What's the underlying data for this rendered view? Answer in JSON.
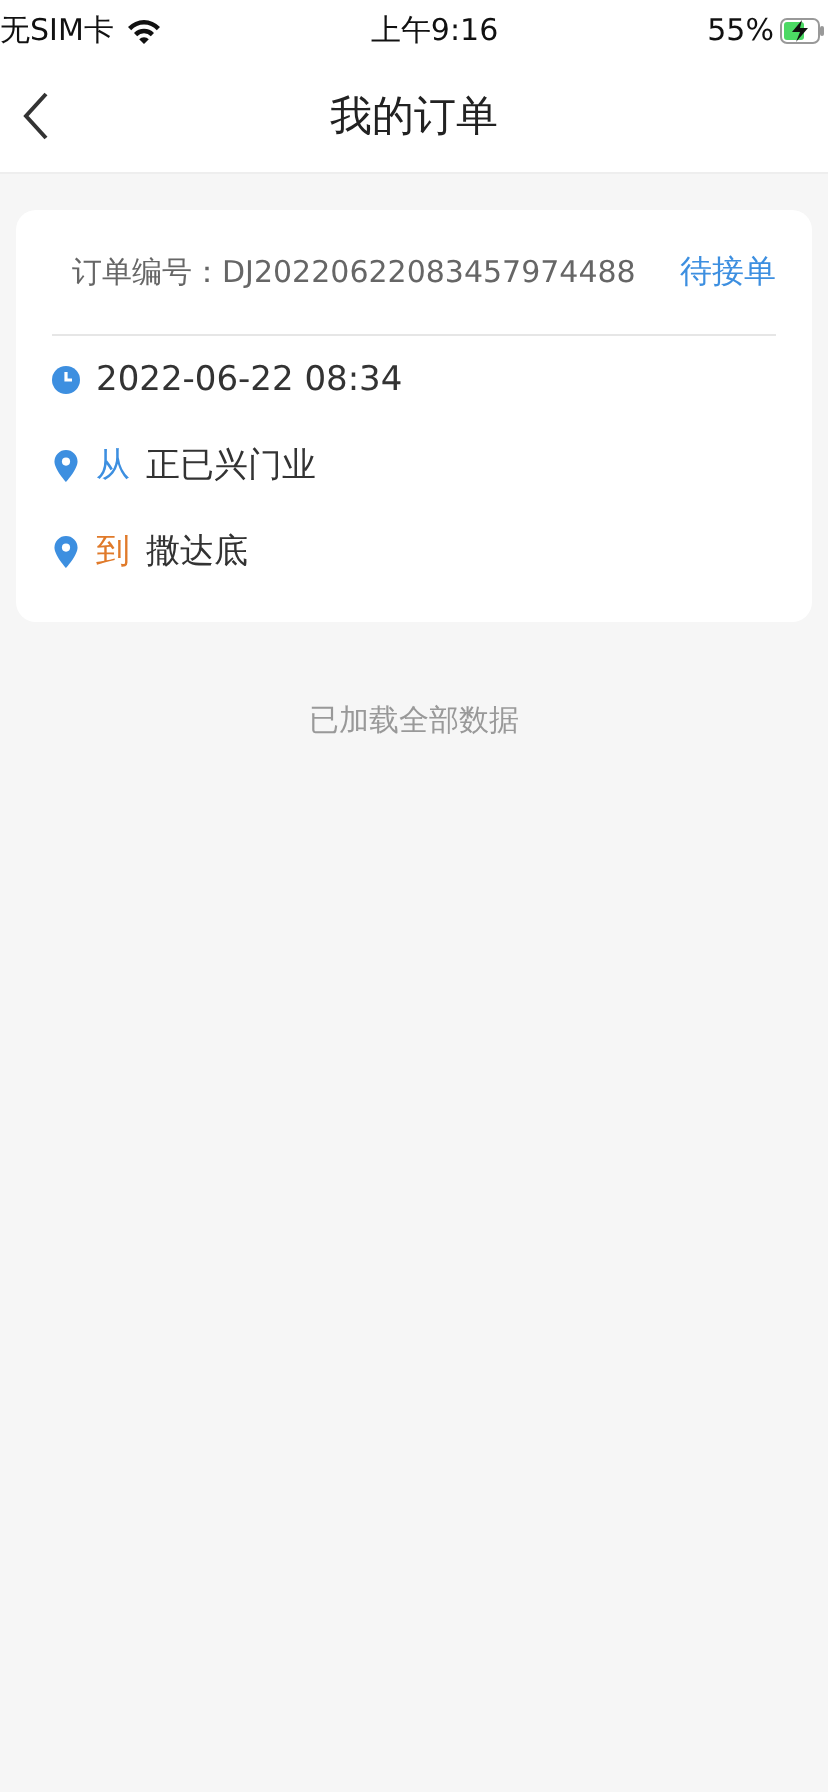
{
  "status_bar": {
    "carrier": "无SIM卡",
    "time": "上午9:16",
    "battery": "55%"
  },
  "nav": {
    "title": "我的订单"
  },
  "orders": [
    {
      "number": "订单编号：DJ20220622083457974488",
      "status": "待接单",
      "rows": [
        {
          "kind": "time",
          "text": "2022-06-22 08:34"
        },
        {
          "kind": "place",
          "tag": "从",
          "color": "#3d8fe0",
          "text": "正已兴门业"
        },
        {
          "kind": "place",
          "tag": "到",
          "color": "#e07a2a",
          "text": "撒达底"
        }
      ]
    }
  ],
  "footer": "已加载全部数据"
}
